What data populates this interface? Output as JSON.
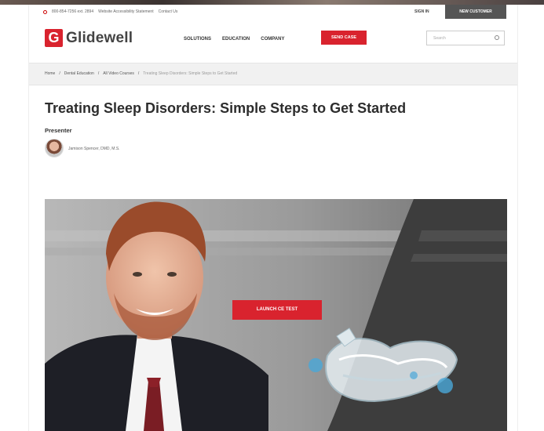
{
  "topbar": {
    "phone": "800-854-7256 ext. 2894",
    "accessibility": "Website Accessibility Statement",
    "contact": "Contact Us",
    "sign_in": "SIGN IN",
    "new_customer": "NEW CUSTOMER"
  },
  "brand": {
    "mark": "G",
    "name": "Glidewell"
  },
  "nav": {
    "items": [
      "SOLUTIONS",
      "EDUCATION",
      "COMPANY"
    ],
    "send_case": "SEND CASE"
  },
  "search": {
    "placeholder": "Search"
  },
  "breadcrumb": {
    "items": [
      "Home",
      "Dental Education",
      "All Video Courses",
      "Treating Sleep Disorders: Simple Steps to Get Started"
    ]
  },
  "page": {
    "title": "Treating Sleep Disorders: Simple Steps to Get Started",
    "presenter_label": "Presenter",
    "presenter_name": "Jamison Spencer, DMD, M.S."
  },
  "hero": {
    "launch_label": "LAUNCH CE TEST"
  },
  "colors": {
    "brand_red": "#d9232e",
    "dark_gray": "#555555",
    "breadcrumb_bg": "#f1f1f1"
  }
}
